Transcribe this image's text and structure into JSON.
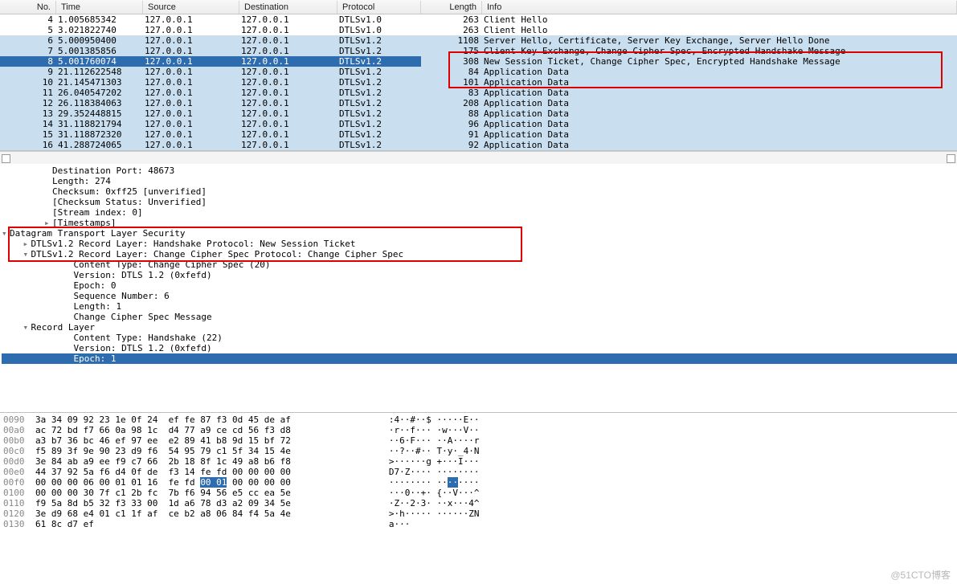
{
  "columns": {
    "no": "No.",
    "time": "Time",
    "source": "Source",
    "destination": "Destination",
    "protocol": "Protocol",
    "length": "Length",
    "info": "Info"
  },
  "packets": [
    {
      "no": "4",
      "time": "1.005685342",
      "src": "127.0.0.1",
      "dst": "127.0.0.1",
      "proto": "DTLSv1.0",
      "len": "263",
      "info": "Client Hello",
      "bg": "plain"
    },
    {
      "no": "5",
      "time": "3.021822740",
      "src": "127.0.0.1",
      "dst": "127.0.0.1",
      "proto": "DTLSv1.0",
      "len": "263",
      "info": "Client Hello",
      "bg": "plain"
    },
    {
      "no": "6",
      "time": "5.000950400",
      "src": "127.0.0.1",
      "dst": "127.0.0.1",
      "proto": "DTLSv1.2",
      "len": "1108",
      "info": "Server Hello, Certificate, Server Key Exchange, Server Hello Done",
      "bg": "blue"
    },
    {
      "no": "7",
      "time": "5.001385856",
      "src": "127.0.0.1",
      "dst": "127.0.0.1",
      "proto": "DTLSv1.2",
      "len": "175",
      "info": "Client Key Exchange, Change Cipher Spec, Encrypted Handshake Message",
      "bg": "blue"
    },
    {
      "no": "8",
      "time": "5.001760074",
      "src": "127.0.0.1",
      "dst": "127.0.0.1",
      "proto": "DTLSv1.2",
      "len": "308",
      "info": "New Session Ticket, Change Cipher Spec, Encrypted Handshake Message",
      "bg": "blue",
      "selected": true
    },
    {
      "no": "9",
      "time": "21.112622548",
      "src": "127.0.0.1",
      "dst": "127.0.0.1",
      "proto": "DTLSv1.2",
      "len": "84",
      "info": "Application Data",
      "bg": "blue"
    },
    {
      "no": "10",
      "time": "21.145471303",
      "src": "127.0.0.1",
      "dst": "127.0.0.1",
      "proto": "DTLSv1.2",
      "len": "101",
      "info": "Application Data",
      "bg": "blue"
    },
    {
      "no": "11",
      "time": "26.040547202",
      "src": "127.0.0.1",
      "dst": "127.0.0.1",
      "proto": "DTLSv1.2",
      "len": "83",
      "info": "Application Data",
      "bg": "blue"
    },
    {
      "no": "12",
      "time": "26.118384063",
      "src": "127.0.0.1",
      "dst": "127.0.0.1",
      "proto": "DTLSv1.2",
      "len": "208",
      "info": "Application Data",
      "bg": "blue"
    },
    {
      "no": "13",
      "time": "29.352448815",
      "src": "127.0.0.1",
      "dst": "127.0.0.1",
      "proto": "DTLSv1.2",
      "len": "88",
      "info": "Application Data",
      "bg": "blue"
    },
    {
      "no": "14",
      "time": "31.118821794",
      "src": "127.0.0.1",
      "dst": "127.0.0.1",
      "proto": "DTLSv1.2",
      "len": "96",
      "info": "Application Data",
      "bg": "blue"
    },
    {
      "no": "15",
      "time": "31.118872320",
      "src": "127.0.0.1",
      "dst": "127.0.0.1",
      "proto": "DTLSv1.2",
      "len": "91",
      "info": "Application Data",
      "bg": "blue"
    },
    {
      "no": "16",
      "time": "41.288724065",
      "src": "127.0.0.1",
      "dst": "127.0.0.1",
      "proto": "DTLSv1.2",
      "len": "92",
      "info": "Application Data",
      "bg": "blue"
    }
  ],
  "details": {
    "lines": [
      {
        "indent": 2,
        "caret": "",
        "text": "Destination Port: 48673"
      },
      {
        "indent": 2,
        "caret": "",
        "text": "Length: 274"
      },
      {
        "indent": 2,
        "caret": "",
        "text": "Checksum: 0xff25 [unverified]"
      },
      {
        "indent": 2,
        "caret": "",
        "text": "[Checksum Status: Unverified]"
      },
      {
        "indent": 2,
        "caret": "",
        "text": "[Stream index: 0]"
      },
      {
        "indent": 2,
        "caret": "▸",
        "text": "[Timestamps]"
      },
      {
        "indent": 0,
        "caret": "▾",
        "text": "Datagram Transport Layer Security"
      },
      {
        "indent": 1,
        "caret": "▸",
        "text": "DTLSv1.2 Record Layer: Handshake Protocol: New Session Ticket"
      },
      {
        "indent": 1,
        "caret": "▾",
        "text": "DTLSv1.2 Record Layer: Change Cipher Spec Protocol: Change Cipher Spec"
      },
      {
        "indent": 3,
        "caret": "",
        "text": "Content Type: Change Cipher Spec (20)"
      },
      {
        "indent": 3,
        "caret": "",
        "text": "Version: DTLS 1.2 (0xfefd)"
      },
      {
        "indent": 3,
        "caret": "",
        "text": "Epoch: 0"
      },
      {
        "indent": 3,
        "caret": "",
        "text": "Sequence Number: 6"
      },
      {
        "indent": 3,
        "caret": "",
        "text": "Length: 1"
      },
      {
        "indent": 3,
        "caret": "",
        "text": "Change Cipher Spec Message"
      },
      {
        "indent": 1,
        "caret": "▾",
        "text": "Record Layer"
      },
      {
        "indent": 3,
        "caret": "",
        "text": "Content Type: Handshake (22)"
      },
      {
        "indent": 3,
        "caret": "",
        "text": "Version: DTLS 1.2 (0xfefd)"
      },
      {
        "indent": 3,
        "caret": "",
        "text": "Epoch: 1",
        "selected": true
      }
    ]
  },
  "hex": {
    "rows": [
      {
        "off": "0090",
        "bytes": "3a 34 09 92 23 1e 0f 24  ef fe 87 f3 0d 45 de af",
        "ascii": ":4··#··$ ·····E··"
      },
      {
        "off": "00a0",
        "bytes": "ac 72 bd f7 66 0a 98 1c  d4 77 a9 ce cd 56 f3 d8",
        "ascii": "·r··f··· ·w···V··"
      },
      {
        "off": "00b0",
        "bytes": "a3 b7 36 bc 46 ef 97 ee  e2 89 41 b8 9d 15 bf 72",
        "ascii": "··6·F··· ··A····r"
      },
      {
        "off": "00c0",
        "bytes": "f5 89 3f 9e 90 23 d9 f6  54 95 79 c1 5f 34 15 4e",
        "ascii": "··?··#·· T·y·_4·N"
      },
      {
        "off": "00d0",
        "bytes": "3e 84 ab a9 ee f9 c7 66  2b 18 8f 1c 49 a8 b6 f8",
        "ascii": ">······g +···I···"
      },
      {
        "off": "00e0",
        "bytes": "44 37 92 5a f6 d4 0f de  f3 14 fe fd 00 00 00 00",
        "ascii": "D7·Z···· ········"
      },
      {
        "off": "00f0",
        "bytes": "00 00 00 06 00 01 01 16  fe fd [00 01] 00 00 00 00",
        "ascii": "········ ··[··]····",
        "sel": true
      },
      {
        "off": "0100",
        "bytes": "00 00 00 30 7f c1 2b fc  7b f6 94 56 e5 cc ea 5e",
        "ascii": "···0··+· {··V···^"
      },
      {
        "off": "0110",
        "bytes": "f9 5a 8d b5 32 f3 33 00  1d a6 78 d3 a2 09 34 5e",
        "ascii": "·Z··2·3· ··x···4^"
      },
      {
        "off": "0120",
        "bytes": "3e d9 68 e4 01 c1 1f af  ce b2 a8 06 84 f4 5a 4e",
        "ascii": ">·h····· ······ZN"
      },
      {
        "off": "0130",
        "bytes": "61 8c d7 ef",
        "ascii": "a···"
      }
    ]
  },
  "watermark": "@51CTO博客"
}
